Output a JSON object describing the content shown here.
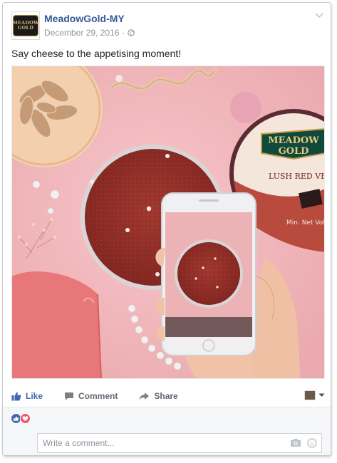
{
  "post": {
    "page_name": "MeadowGold-MY",
    "date": "December 29, 2016",
    "separator": "·",
    "text": "Say cheese to the appetising moment!",
    "avatar_logo": [
      "MEADOW",
      "GOLD"
    ]
  },
  "photo": {
    "tub_brand_line1": "MEADOW",
    "tub_brand_line2": "GOLD",
    "tub_flavor": "LUSH RED VE",
    "tub_weight": "Min. Net Volu"
  },
  "actions": {
    "like": "Like",
    "comment": "Comment",
    "share": "Share"
  },
  "comment": {
    "placeholder": "Write a comment..."
  },
  "colors": {
    "link_blue": "#365899",
    "like_blue": "#4267b2",
    "meta_gray": "#90949c",
    "background_pink": "#f1b9bd"
  },
  "icons": [
    "globe-icon",
    "chevron-down-icon",
    "like-icon",
    "comment-icon",
    "share-icon",
    "like-reaction-icon",
    "love-reaction-icon",
    "camera-icon",
    "emoji-icon"
  ]
}
